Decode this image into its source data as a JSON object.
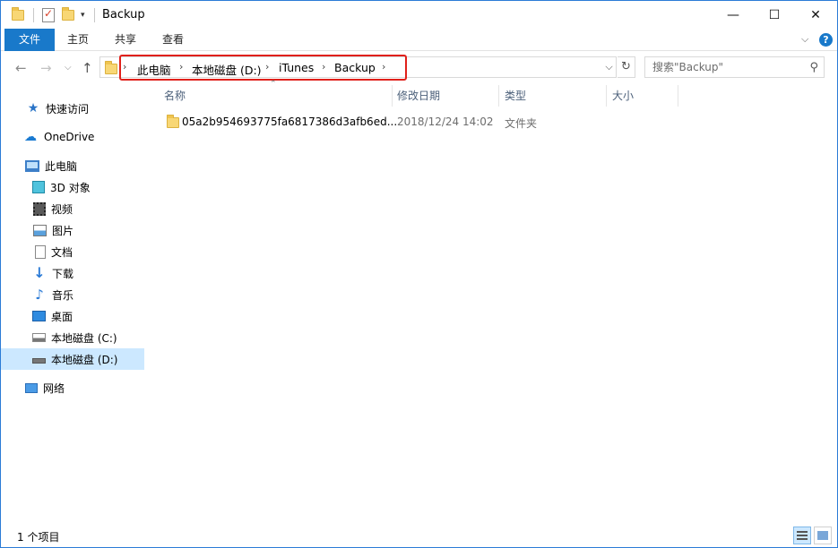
{
  "window": {
    "title": "Backup",
    "controls": {
      "minimize": "—",
      "maximize": "☐",
      "close": "✕"
    }
  },
  "ribbon": {
    "tabs": [
      "文件",
      "主页",
      "共享",
      "查看"
    ],
    "expand_icon": "chevron-down-icon",
    "help_label": "?"
  },
  "nav": {
    "breadcrumbs": [
      "此电脑",
      "本地磁盘 (D:)",
      "iTunes",
      "Backup"
    ],
    "search_placeholder": "搜索\"Backup\""
  },
  "sidebar": {
    "items": [
      {
        "label": "快速访问",
        "icon": "star-icon"
      },
      {
        "label": "OneDrive",
        "icon": "cloud-icon"
      },
      {
        "label": "此电脑",
        "icon": "computer-icon"
      },
      {
        "label": "3D 对象",
        "icon": "cube-icon"
      },
      {
        "label": "视频",
        "icon": "video-icon"
      },
      {
        "label": "图片",
        "icon": "picture-icon"
      },
      {
        "label": "文档",
        "icon": "document-icon"
      },
      {
        "label": "下载",
        "icon": "download-icon"
      },
      {
        "label": "音乐",
        "icon": "music-icon"
      },
      {
        "label": "桌面",
        "icon": "desktop-icon"
      },
      {
        "label": "本地磁盘 (C:)",
        "icon": "drive-icon"
      },
      {
        "label": "本地磁盘 (D:)",
        "icon": "drive-icon",
        "selected": true
      },
      {
        "label": "网络",
        "icon": "network-icon"
      }
    ]
  },
  "columns": [
    "名称",
    "修改日期",
    "类型",
    "大小"
  ],
  "files": [
    {
      "name": "05a2b954693775fa6817386d3afb6ed...",
      "modified": "2018/12/24 14:02",
      "type": "文件夹",
      "size": ""
    }
  ],
  "status": {
    "count_text": "1 个项目"
  },
  "colors": {
    "accent": "#1979ca",
    "selection": "#cce8ff",
    "highlight_box": "#e0201a"
  }
}
